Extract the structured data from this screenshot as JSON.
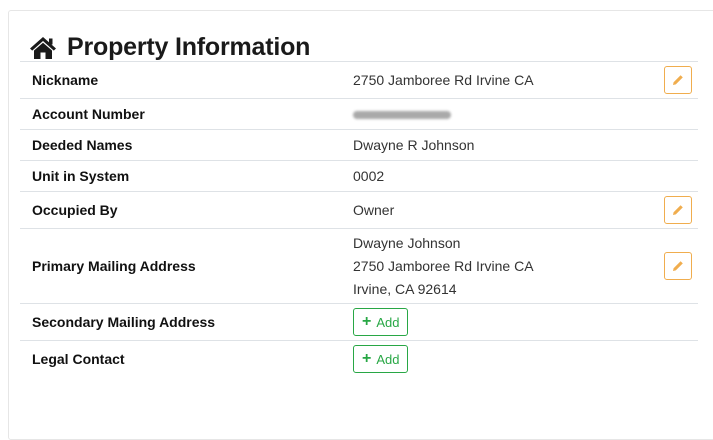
{
  "title": "Property Information",
  "icons": {
    "header": "home-icon",
    "edit": "pencil-icon",
    "add": "plus-icon"
  },
  "colors": {
    "edit_accent": "#f0ad4e",
    "add_accent": "#28a745"
  },
  "rows": {
    "nickname": {
      "label": "Nickname",
      "value": "2750 Jamboree Rd Irvine CA"
    },
    "account_number": {
      "label": "Account Number",
      "value_redacted": true
    },
    "deeded_names": {
      "label": "Deeded Names",
      "value": "Dwayne R Johnson"
    },
    "unit_in_system": {
      "label": "Unit in System",
      "value": "0002"
    },
    "occupied_by": {
      "label": "Occupied By",
      "value": "Owner"
    },
    "primary_mailing_address": {
      "label": "Primary Mailing Address",
      "lines": [
        "Dwayne Johnson",
        "2750 Jamboree Rd Irvine CA",
        "Irvine, CA 92614"
      ]
    },
    "secondary_mailing_address": {
      "label": "Secondary Mailing Address",
      "button": "Add"
    },
    "legal_contact": {
      "label": "Legal Contact",
      "button": "Add"
    }
  }
}
